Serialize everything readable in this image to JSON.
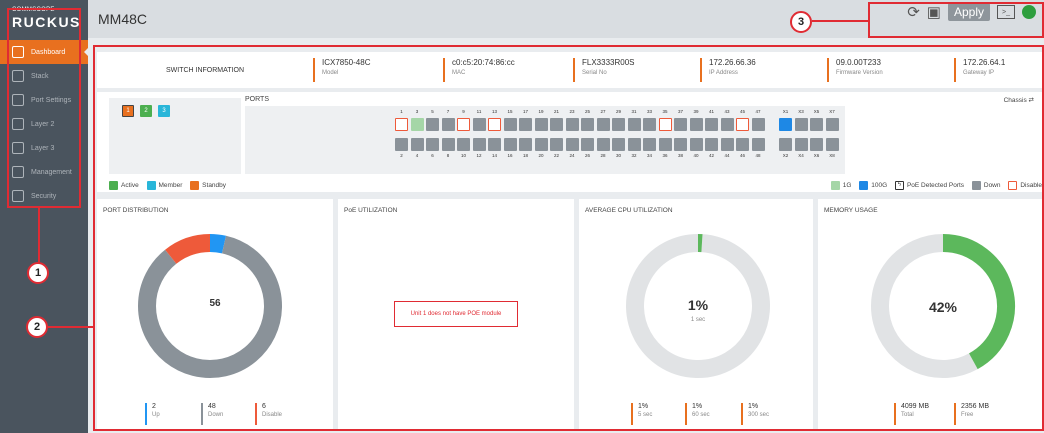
{
  "brand": {
    "line1": "COMMSCOPE",
    "line2": "RUCKUS"
  },
  "nav": [
    "Dashboard",
    "Stack",
    "Port Settings",
    "Layer 2",
    "Layer 3",
    "Management",
    "Security"
  ],
  "device_title": "MM48C",
  "toolbar": {
    "apply": "Apply"
  },
  "annotations": [
    "1",
    "2",
    "3"
  ],
  "switch_info": {
    "title": "SWITCH INFORMATION",
    "items": [
      {
        "value": "ICX7850-48C",
        "label": "Model"
      },
      {
        "value": "c0:c5:20:74:86:cc",
        "label": "MAC"
      },
      {
        "value": "FLX3333R00S",
        "label": "Serial No"
      },
      {
        "value": "172.26.66.36",
        "label": "IP Address"
      },
      {
        "value": "09.0.00T233",
        "label": "Firmware Version"
      },
      {
        "value": "172.26.64.1",
        "label": "Gateway IP"
      }
    ]
  },
  "ports_panel": {
    "label": "PORTS",
    "chassis": "Chassis",
    "units": [
      "1",
      "2",
      "3"
    ],
    "top_numbers": [
      "1",
      "3",
      "5",
      "7",
      "9",
      "11",
      "13",
      "15",
      "17",
      "19",
      "21",
      "23",
      "25",
      "27",
      "29",
      "31",
      "33",
      "35",
      "37",
      "39",
      "41",
      "43",
      "45",
      "47"
    ],
    "bottom_numbers": [
      "2",
      "4",
      "6",
      "8",
      "10",
      "12",
      "14",
      "16",
      "18",
      "20",
      "22",
      "24",
      "26",
      "28",
      "30",
      "32",
      "34",
      "36",
      "38",
      "40",
      "42",
      "44",
      "46",
      "48"
    ],
    "uplink_top": [
      "X1",
      "X3",
      "X5",
      "X7"
    ],
    "uplink_bottom": [
      "X2",
      "X4",
      "X6",
      "X8"
    ],
    "unit_legend": [
      "Active",
      "Member",
      "Standby"
    ],
    "port_legend": [
      "1G",
      "100G",
      "PoE Detected Ports",
      "Down",
      "Disable"
    ]
  },
  "port_distribution": {
    "title": "PORT DISTRIBUTION",
    "total": "56",
    "stats": [
      {
        "value": "2",
        "label": "Up"
      },
      {
        "value": "48",
        "label": "Down"
      },
      {
        "value": "6",
        "label": "Disable"
      }
    ],
    "counts": {
      "up": 2,
      "down": 48,
      "disable": 6
    }
  },
  "poe": {
    "title": "PoE UTILIZATION",
    "message": "Unit 1 does not have POE module"
  },
  "cpu": {
    "title": "AVERAGE CPU UTILIZATION",
    "value": "1%",
    "sub": "1 sec",
    "percent": 1,
    "stats": [
      {
        "value": "1%",
        "label": "5 sec"
      },
      {
        "value": "1%",
        "label": "60 sec"
      },
      {
        "value": "1%",
        "label": "300 sec"
      }
    ]
  },
  "memory": {
    "title": "MEMORY USAGE",
    "value": "42%",
    "percent": 42,
    "stats": [
      {
        "value": "4099 MB",
        "label": "Total"
      },
      {
        "value": "2356 MB",
        "label": "Free"
      }
    ]
  },
  "colors": {
    "accent": "#e8701f",
    "up": "#2196f3",
    "down": "#8a9299",
    "disable": "#ee5a3a",
    "active": "#4caf50",
    "annotation": "#e02b33"
  }
}
